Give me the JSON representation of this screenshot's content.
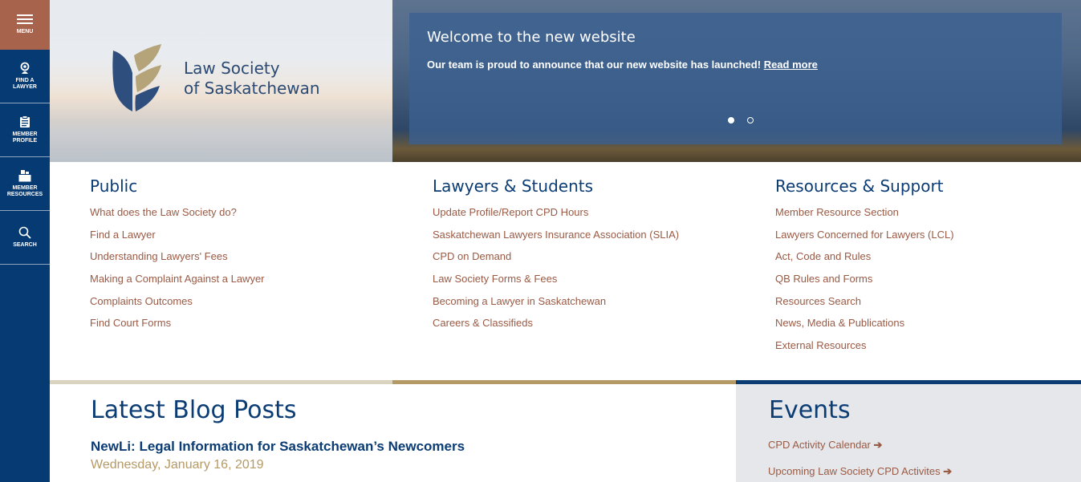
{
  "sidebar": {
    "menu_label": "MENU",
    "items": [
      {
        "label_line1": "FIND A",
        "label_line2": "LAWYER",
        "icon": "search-person-icon"
      },
      {
        "label_line1": "MEMBER",
        "label_line2": "PROFILE",
        "icon": "clipboard-icon"
      },
      {
        "label_line1": "MEMBER",
        "label_line2": "RESOURCES",
        "icon": "resources-icon"
      },
      {
        "label_line1": "SEARCH",
        "label_line2": "",
        "icon": "search-icon"
      }
    ]
  },
  "logo": {
    "line1": "Law Society",
    "line2": "of Saskatchewan"
  },
  "banner": {
    "title": "Welcome to the new website",
    "text": "Our team is proud to announce that our new website has launched!",
    "link": "Read more"
  },
  "columns": [
    {
      "title": "Public",
      "links": [
        "What does the Law Society do?",
        "Find a Lawyer",
        "Understanding Lawyers' Fees",
        "Making a Complaint Against a Lawyer",
        "Complaints Outcomes",
        "Find Court Forms"
      ]
    },
    {
      "title": "Lawyers & Students",
      "links": [
        "Update Profile/Report CPD Hours",
        "Saskatchewan Lawyers Insurance Association (SLIA)",
        "CPD on Demand",
        "Law Society Forms & Fees",
        "Becoming a Lawyer in Saskatchewan",
        "Careers & Classifieds"
      ]
    },
    {
      "title": "Resources & Support",
      "links": [
        "Member Resource Section",
        "Lawyers Concerned for Lawyers (LCL)",
        "Act, Code and Rules",
        "QB Rules and Forms",
        "Resources Search",
        "News, Media & Publications",
        "External Resources"
      ]
    }
  ],
  "blog": {
    "title": "Latest Blog Posts",
    "post_title": "NewLi: Legal Information for Saskatchewan’s Newcomers",
    "post_date": "Wednesday, January 16, 2019"
  },
  "events": {
    "title": "Events",
    "links": [
      "CPD Activity Calendar",
      "Upcoming Law Society CPD Activites"
    ]
  },
  "colors": {
    "navy": "#063a72",
    "rust": "#a8634d",
    "link": "#9a5a44",
    "gold": "#b59a66"
  }
}
